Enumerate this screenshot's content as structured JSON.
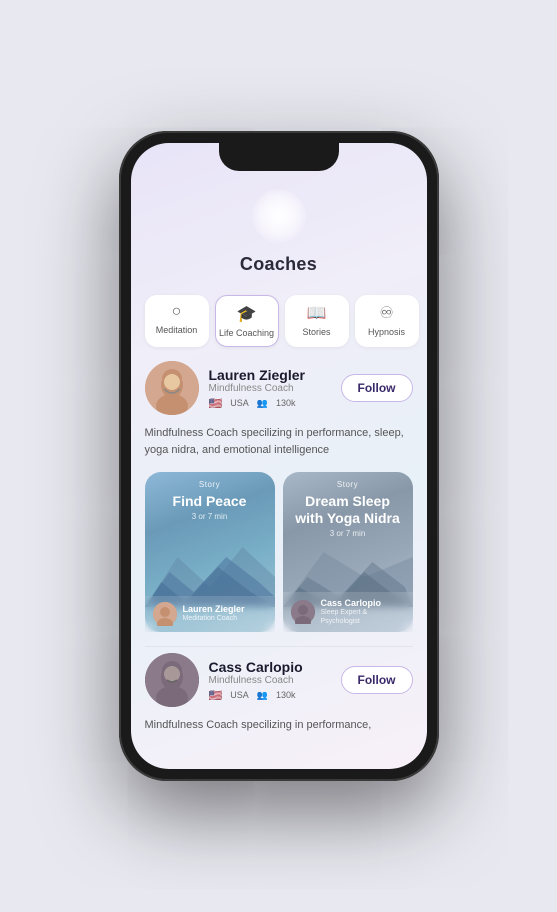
{
  "page": {
    "title": "Coaches"
  },
  "categories": [
    {
      "id": "meditation",
      "label": "Meditation",
      "icon": "○",
      "active": false
    },
    {
      "id": "life-coaching",
      "label": "Life Coaching",
      "icon": "🎓",
      "active": true
    },
    {
      "id": "stories",
      "label": "Stories",
      "icon": "📖",
      "active": false
    },
    {
      "id": "hypnosis",
      "label": "Hypnosis",
      "icon": "♾",
      "active": false
    }
  ],
  "coaches": [
    {
      "id": "lauren",
      "name": "Lauren Ziegler",
      "role": "Mindfulness Coach",
      "country": "USA",
      "followers": "130k",
      "description": "Mindfulness Coach specilizing in performance, sleep, yoga nidra, and emotional intelligence",
      "follow_label": "Follow",
      "stories": [
        {
          "tag": "Story",
          "title": "Find Peace",
          "duration": "3 or 7 min",
          "author_name": "Lauren Ziegler",
          "author_role": "Meditation Coach",
          "card_type": "blue"
        },
        {
          "tag": "Story",
          "title": "Dream Sleep with Yoga Nidra",
          "duration": "3 or 7 min",
          "author_name": "Cass Carlopio",
          "author_role": "Sleep Expert & Psychologist",
          "card_type": "gray"
        }
      ]
    },
    {
      "id": "cass",
      "name": "Cass Carlopio",
      "role": "Mindfulness Coach",
      "country": "USA",
      "followers": "130k",
      "description": "Mindfulness Coach specilizing in performance,",
      "follow_label": "Follow"
    }
  ]
}
